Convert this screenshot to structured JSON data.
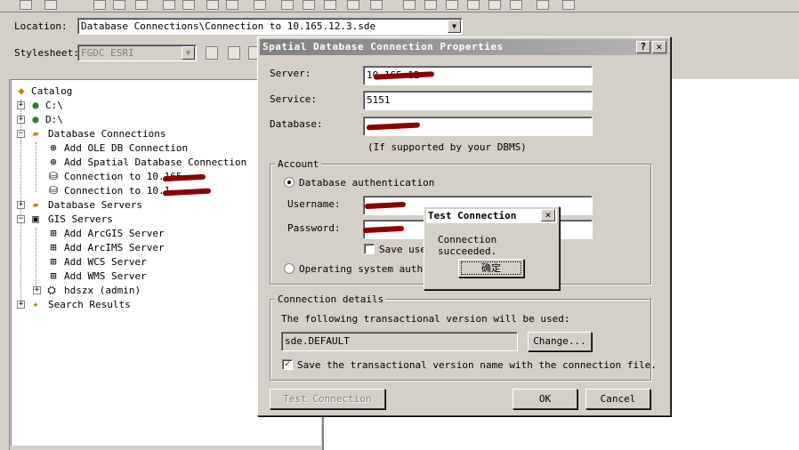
{
  "location": {
    "label": "Location:",
    "value": "Database Connections\\Connection to 10.165.12.3.sde"
  },
  "stylesheet": {
    "label": "Stylesheet:",
    "value": "FGDC ESRI"
  },
  "tree": {
    "root": "Catalog",
    "items": [
      "C:\\",
      "D:\\",
      "Database Connections",
      "Add OLE DB Connection",
      "Add Spatial Database Connection",
      "Connection to 10.165",
      "Connection to 10.1",
      "Database Servers",
      "GIS Servers",
      "Add ArcGIS Server",
      "Add ArcIMS Server",
      "Add WCS Server",
      "Add WMS Server",
      "hdszx (admin)",
      "Search Results"
    ]
  },
  "dialog": {
    "title": "Spatial Database Connection Properties",
    "help": "?",
    "close": "✕",
    "server_label": "Server:",
    "server_value": "10.165.12",
    "service_label": "Service:",
    "service_value": "5151",
    "database_label": "Database:",
    "database_value": "",
    "database_hint": "(If supported by your DBMS)",
    "account": {
      "title": "Account",
      "db_auth": "Database authentication",
      "username_label": "Username:",
      "password_label": "Password:",
      "save_user": "Save use",
      "os_auth": "Operating system authen"
    },
    "details": {
      "title": "Connection details",
      "text": "The following transactional version will be used:",
      "version": "sde.DEFAULT",
      "change": "Change...",
      "save_version": "Save the transactional version name with the connection file."
    },
    "test_button": "Test Connection",
    "ok": "OK",
    "cancel": "Cancel"
  },
  "popup": {
    "title": "Test Connection",
    "close": "✕",
    "message": "Connection succeeded.",
    "ok": "确定"
  }
}
